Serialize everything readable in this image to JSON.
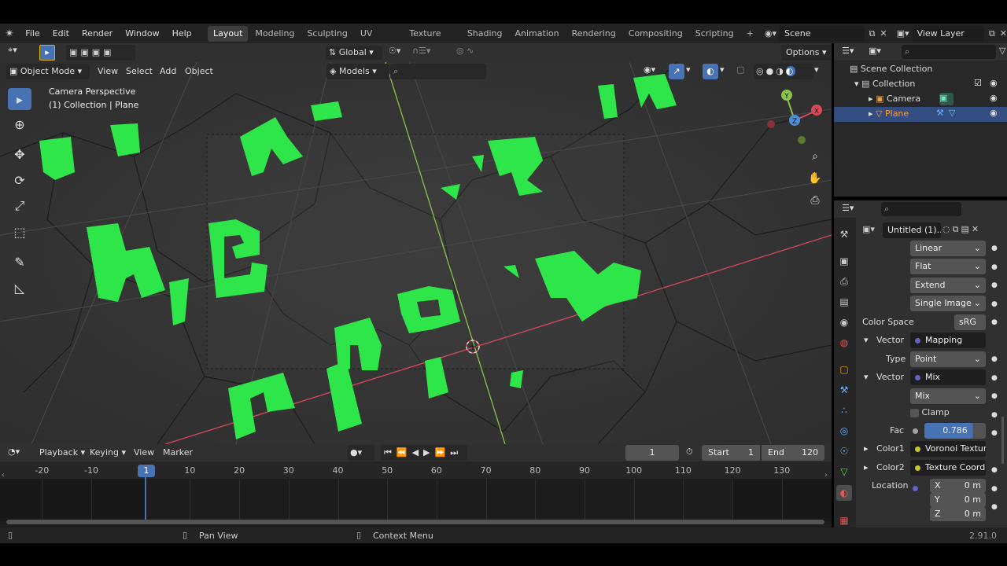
{
  "colors": {
    "accent": "#4772b3",
    "green": "#2fe64a",
    "x_axis": "#d8495b",
    "y_axis": "#8bc34a"
  },
  "menubar": {
    "items": [
      "File",
      "Edit",
      "Render",
      "Window",
      "Help"
    ]
  },
  "workspaces": [
    "Layout",
    "Modeling",
    "Sculpting",
    "UV Editing",
    "Texture Paint",
    "Shading",
    "Animation",
    "Rendering",
    "Compositing",
    "Scripting"
  ],
  "scene": {
    "label": "Scene"
  },
  "viewlayer": {
    "label": "View Layer"
  },
  "toolheader": {
    "transform": "Global",
    "options": "Options"
  },
  "viewport_header": {
    "mode": "Object Mode",
    "menus": [
      "View",
      "Select",
      "Add",
      "Object"
    ],
    "collection": "Models"
  },
  "viewport": {
    "camera_label": "Camera Perspective",
    "collection_label": "(1) Collection | Plane"
  },
  "gizmo": {
    "x": "X",
    "y": "Y",
    "z": "Z"
  },
  "outliner": {
    "scene_collection": "Scene Collection",
    "collection": "Collection",
    "camera": "Camera",
    "plane": "Plane"
  },
  "properties": {
    "image_name": "Untitled (1)...",
    "interp": "Linear",
    "proj": "Flat",
    "ext": "Extend",
    "source": "Single Image",
    "color_space_label": "Color Space",
    "color_space": "sRG",
    "vector1_label": "Vector",
    "vector1": "Mapping",
    "type_label": "Type",
    "type": "Point",
    "vector2_label": "Vector",
    "vector2": "Mix",
    "mix_mode": "Mix",
    "clamp": "Clamp",
    "fac_label": "Fac",
    "fac": "0.786",
    "color1_label": "Color1",
    "color1": "Voronoi Texture",
    "color2_label": "Color2",
    "color2": "Texture Coordi...",
    "location_label": "Location",
    "loc_x_label": "X",
    "loc_x": "0 m",
    "loc_y_label": "Y",
    "loc_y": "0 m",
    "loc_z_label": "Z",
    "loc_z": "0 m"
  },
  "timeline": {
    "menus": [
      "Playback",
      "Keying",
      "View",
      "Marker"
    ],
    "current_frame": "1",
    "start_label": "Start",
    "start": "1",
    "end_label": "End",
    "end": "120",
    "ticks": [
      "-20",
      "-10",
      "1",
      "10",
      "20",
      "30",
      "40",
      "50",
      "60",
      "70",
      "80",
      "90",
      "100",
      "110",
      "120",
      "130"
    ]
  },
  "status": {
    "pan": "Pan View",
    "context": "Context Menu",
    "version": "2.91.0"
  }
}
